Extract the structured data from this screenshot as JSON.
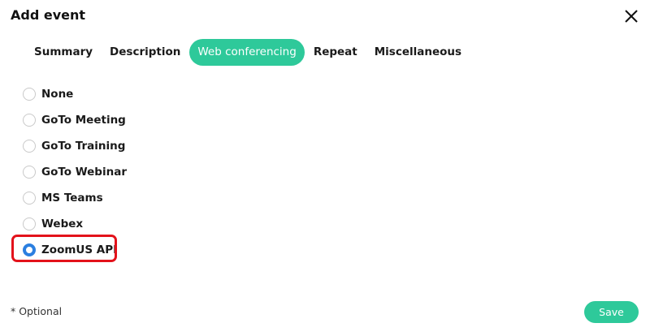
{
  "dialog": {
    "title": "Add event",
    "close_icon": "close-icon"
  },
  "tabs": [
    {
      "label": "Summary",
      "active": false
    },
    {
      "label": "Description",
      "active": false
    },
    {
      "label": "Web conferencing",
      "active": true
    },
    {
      "label": "Repeat",
      "active": false
    },
    {
      "label": "Miscellaneous",
      "active": false
    }
  ],
  "conferencing_options": [
    {
      "label": "None",
      "selected": false
    },
    {
      "label": "GoTo Meeting",
      "selected": false
    },
    {
      "label": "GoTo Training",
      "selected": false
    },
    {
      "label": "GoTo Webinar",
      "selected": false
    },
    {
      "label": "MS Teams",
      "selected": false
    },
    {
      "label": "Webex",
      "selected": false
    },
    {
      "label": "ZoomUS API",
      "selected": true
    }
  ],
  "footer": {
    "optional_note": "* Optional",
    "save_label": "Save"
  },
  "colors": {
    "accent": "#2ec99a",
    "radio_selected": "#2b7fe0",
    "highlight_border": "#e3121b"
  }
}
